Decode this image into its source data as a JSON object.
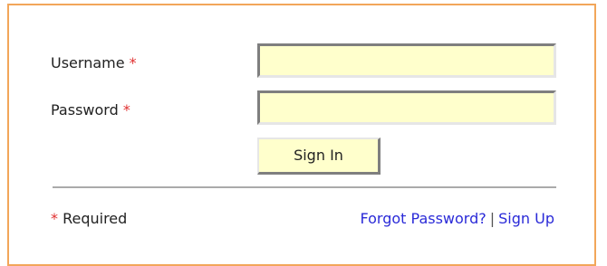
{
  "form": {
    "username_label": "Username",
    "password_label": "Password",
    "required_marker": "*",
    "username_value": "",
    "password_value": "",
    "signin_label": "Sign In"
  },
  "footer": {
    "required_marker": "*",
    "required_text": "Required",
    "forgot_password": "Forgot Password?",
    "separator": "|",
    "sign_up": "Sign Up"
  },
  "colors": {
    "panel_border": "#f2a65a",
    "field_background": "#ffffcc",
    "required_marker": "#e03030",
    "link": "#2a2ad8"
  }
}
